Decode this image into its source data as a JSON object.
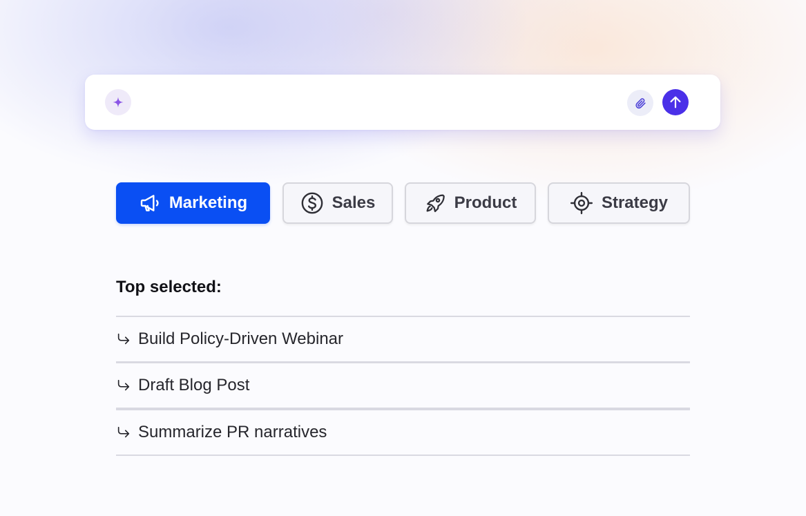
{
  "search": {
    "placeholder": "",
    "value": ""
  },
  "icons": {
    "sparkle": "sparkle-icon",
    "attach": "paperclip-icon",
    "send": "arrow-up-icon",
    "list_item": "arrow-return-right-icon"
  },
  "categories": [
    {
      "label": "Marketing",
      "icon": "megaphone-icon",
      "selected": true
    },
    {
      "label": "Sales",
      "icon": "dollar-circle-icon",
      "selected": false
    },
    {
      "label": "Product",
      "icon": "rocket-icon",
      "selected": false
    },
    {
      "label": "Strategy",
      "icon": "target-icon",
      "selected": false
    }
  ],
  "top_selected": {
    "heading": "Top selected:",
    "items": [
      "Build Policy-Driven Webinar",
      "Draft Blog Post",
      "Summarize PR narratives"
    ]
  },
  "colors": {
    "accent": "#0a4ff3",
    "send": "#4a30e8",
    "sparkle": "#8b55e6"
  }
}
